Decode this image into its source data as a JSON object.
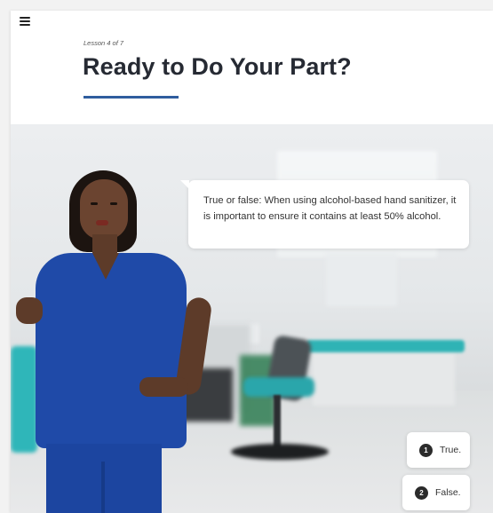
{
  "header": {
    "menu_icon": "hamburger-menu-icon",
    "lesson_label": "Lesson 4 of 7",
    "title": "Ready to Do Your Part?",
    "accent_color": "#2f5d9e"
  },
  "scenario": {
    "question": "True or false: When using alcohol-based hand sanitizer, it is important to ensure it contains at least 50% alcohol.",
    "answers": [
      {
        "number": "1",
        "label": "True."
      },
      {
        "number": "2",
        "label": "False."
      }
    ]
  }
}
